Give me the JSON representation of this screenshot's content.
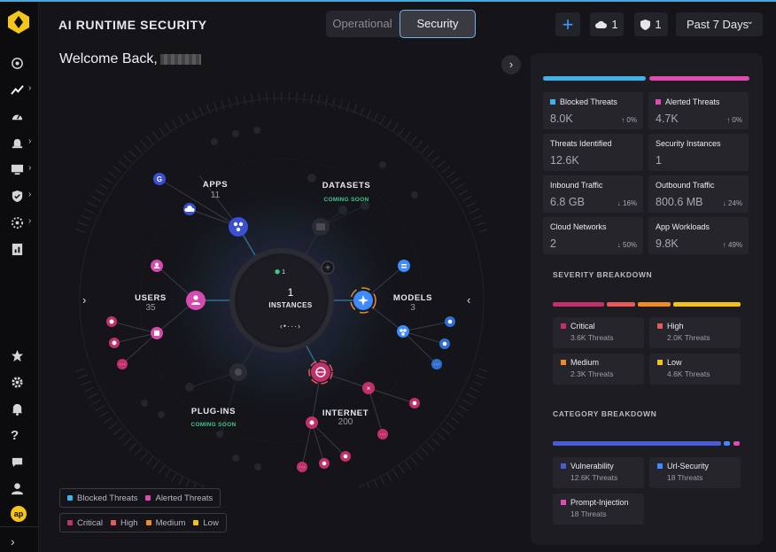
{
  "app": {
    "title": "AI RUNTIME SECURITY",
    "tabs": [
      {
        "label": "Operational",
        "active": false
      },
      {
        "label": "Security",
        "active": true
      }
    ],
    "welcome": "Welcome Back,",
    "cloud_count": "1",
    "shield_count": "1",
    "date_range": "Past 7 Days"
  },
  "sidebar": {
    "icons": [
      "radar-icon",
      "analytics-icon",
      "speedometer-icon",
      "alarm-icon",
      "monitor-icon",
      "shield-check-icon",
      "gear-dots-icon",
      "report-icon",
      "star-icon",
      "settings-icon",
      "bell-icon",
      "help-icon",
      "chat-icon",
      "user-icon"
    ],
    "badge": "ap"
  },
  "graph": {
    "center": {
      "count": "1",
      "label": "INSTANCES",
      "badge": "1",
      "nav": "‹•···›"
    },
    "nodes": [
      {
        "id": "apps",
        "label": "APPS",
        "count": "11"
      },
      {
        "id": "datasets",
        "label": "DATASETS",
        "note": "COMING SOON"
      },
      {
        "id": "users",
        "label": "USERS",
        "count": "35"
      },
      {
        "id": "models",
        "label": "MODELS",
        "count": "3"
      },
      {
        "id": "plugins",
        "label": "PLUG-INS",
        "note": "COMING SOON"
      },
      {
        "id": "internet",
        "label": "INTERNET",
        "count": "200"
      }
    ]
  },
  "legend": {
    "threats": [
      {
        "label": "Blocked Threats",
        "color": "#3fb2ea"
      },
      {
        "label": "Alerted Threats",
        "color": "#e04ab3"
      }
    ],
    "severity": [
      {
        "label": "Critical",
        "color": "#c2306c"
      },
      {
        "label": "High",
        "color": "#e85a5a"
      },
      {
        "label": "Medium",
        "color": "#f08a24"
      },
      {
        "label": "Low",
        "color": "#f2c21a"
      }
    ]
  },
  "panel": {
    "stats": [
      {
        "label": "Blocked Threats",
        "value": "8.0K",
        "delta": "↑ 0%",
        "color": "#3fb2ea"
      },
      {
        "label": "Alerted Threats",
        "value": "4.7K",
        "delta": "↑ 0%",
        "color": "#e04ab3"
      },
      {
        "label": "Threats Identified",
        "value": "12.6K",
        "delta": ""
      },
      {
        "label": "Security Instances",
        "value": "1",
        "delta": ""
      },
      {
        "label": "Inbound Traffic",
        "value": "6.8 GB",
        "delta": "↓ 16%"
      },
      {
        "label": "Outbound Traffic",
        "value": "800.6 MB",
        "delta": "↓ 24%"
      },
      {
        "label": "Cloud Networks",
        "value": "2",
        "delta": "↓ 50%"
      },
      {
        "label": "App Workloads",
        "value": "9.8K",
        "delta": "↑ 49%"
      }
    ],
    "severity_title": "SEVERITY BREAKDOWN",
    "severity": [
      {
        "label": "Critical",
        "sub": "3.6K Threats",
        "color": "#c2306c",
        "share": 0.28
      },
      {
        "label": "High",
        "sub": "2.0K Threats",
        "color": "#e85a5a",
        "share": 0.16
      },
      {
        "label": "Medium",
        "sub": "2.3K Threats",
        "color": "#f08a24",
        "share": 0.18
      },
      {
        "label": "Low",
        "sub": "4.6K Threats",
        "color": "#f2c21a",
        "share": 0.38
      }
    ],
    "category_title": "CATEGORY BREAKDOWN",
    "category": [
      {
        "label": "Vulnerability",
        "sub": "12.6K Threats",
        "color": "#4a5bd8",
        "share": 0.95
      },
      {
        "label": "Url-Security",
        "sub": "18 Threats",
        "color": "#3d8bff",
        "share": 0.025
      },
      {
        "label": "Prompt-Injection",
        "sub": "18 Threats",
        "color": "#e04ab3",
        "share": 0.025
      }
    ]
  }
}
